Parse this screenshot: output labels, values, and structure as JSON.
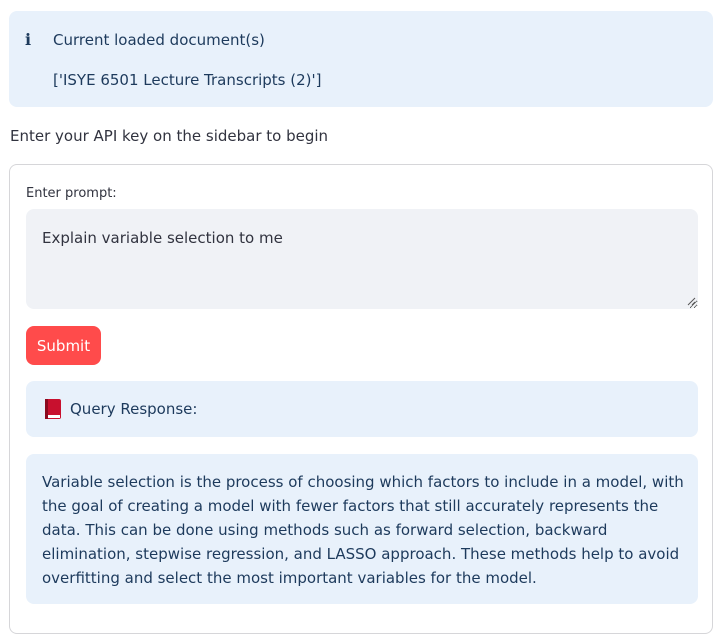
{
  "info": {
    "icon": "info-icon",
    "title": "Current loaded document(s)",
    "documents": "['ISYE 6501 Lecture Transcripts (2)']"
  },
  "api_message": "Enter your API key on the sidebar to begin",
  "form": {
    "prompt_label": "Enter prompt:",
    "prompt_value": "Explain variable selection to me",
    "submit_label": "Submit"
  },
  "query": {
    "icon": "book-icon",
    "title": "Query Response:"
  },
  "response": {
    "text": "Variable selection is the process of choosing which factors to include in a model, with the goal of creating a model with fewer factors that still accurately represents the data. This can be done using methods such as forward selection, backward elimination, stepwise regression, and LASSO approach. These methods help to avoid overfitting and select the most important variables for the model."
  },
  "colors": {
    "accent": "#ff4b4b",
    "info_bg": "#e8f1fb",
    "info_text": "#1d3a5c",
    "input_bg": "#f0f2f6"
  }
}
